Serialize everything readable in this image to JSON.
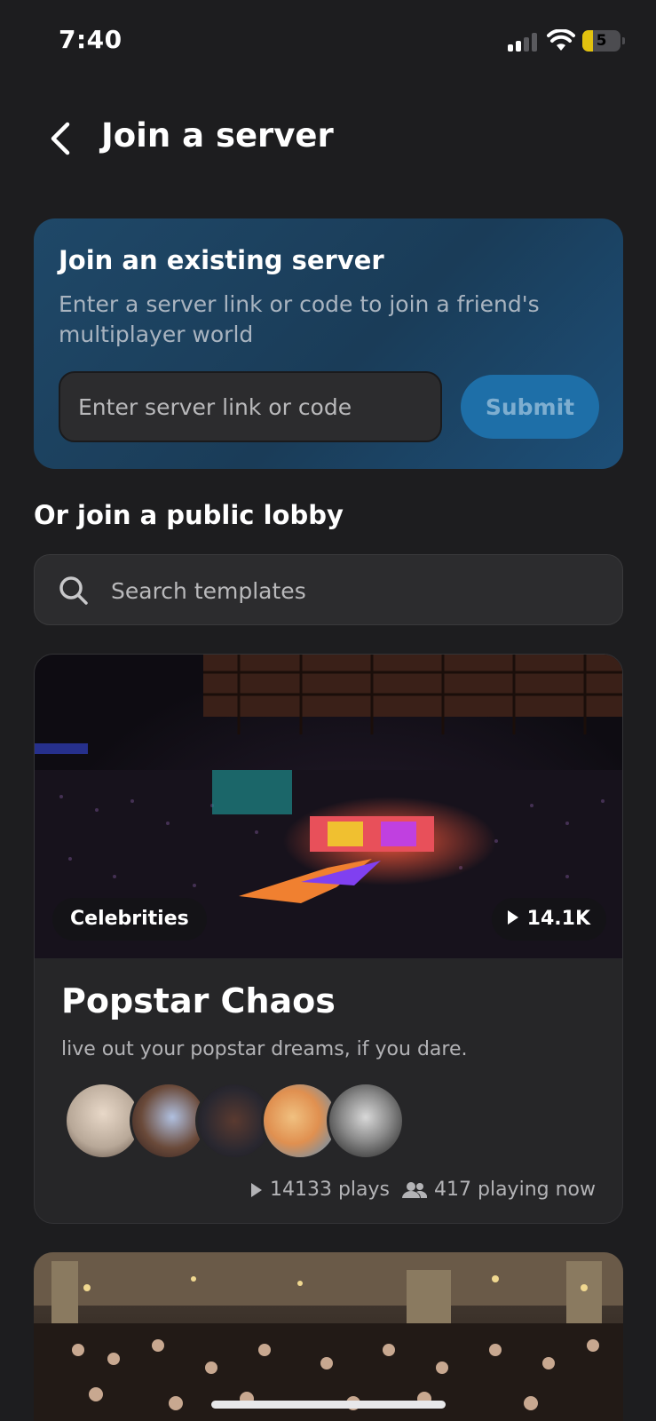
{
  "status_bar": {
    "time": "7:40",
    "battery_level": "5"
  },
  "header": {
    "title": "Join a server"
  },
  "join_card": {
    "title": "Join an existing server",
    "description": "Enter a server link or code to join a friend's multiplayer world",
    "input_placeholder": "Enter server link or code",
    "submit_label": "Submit"
  },
  "public_lobby": {
    "title": "Or join a public lobby",
    "search_placeholder": "Search templates"
  },
  "templates": [
    {
      "category": "Celebrities",
      "plays_badge": "14.1K",
      "title": "Popstar Chaos",
      "description": "live out your popstar dreams, if you dare.",
      "plays_text": "14133 plays",
      "playing_text": "417 playing now"
    }
  ],
  "colors": {
    "background": "#1d1d1f",
    "card": "#262628",
    "accent": "#1e6fa8",
    "join_card": "#1f4868"
  }
}
